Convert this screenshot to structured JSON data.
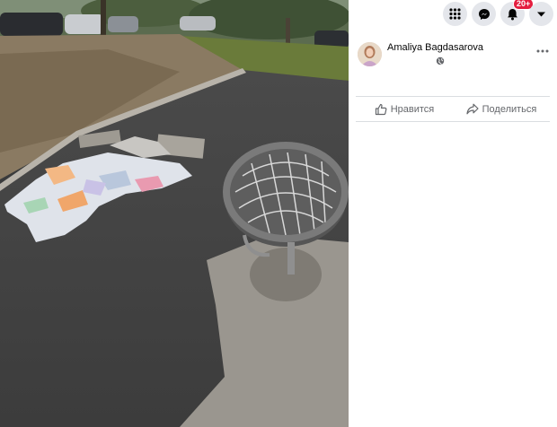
{
  "post": {
    "author_name": "Amaliya Bagdasarova",
    "privacy_icon": "globe-icon",
    "more_icon": "more-dots-icon"
  },
  "actions": {
    "like_label": "Нравится",
    "share_label": "Поделиться"
  },
  "topbar": {
    "menu_icon": "grid-menu-icon",
    "messenger_icon": "messenger-icon",
    "notifications_icon": "bell-icon",
    "notifications_badge": "20+",
    "account_icon": "caret-down-icon"
  },
  "colors": {
    "badge": "#e41e3f",
    "button_bg": "#e4e6eb",
    "divider": "#dadde1",
    "secondary_text": "#65676b"
  }
}
